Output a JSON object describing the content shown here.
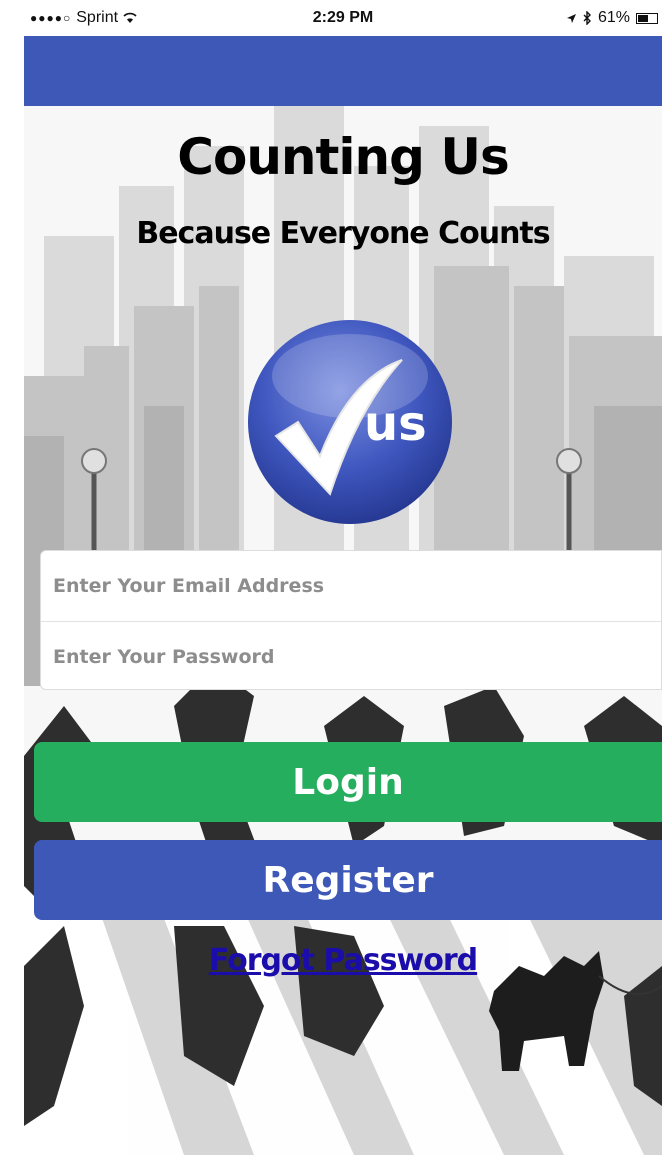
{
  "status_bar": {
    "signal": "●●●●○",
    "carrier": "Sprint",
    "time": "2:29 PM",
    "battery": "61%",
    "battery_level": 0.61
  },
  "header": {
    "title": "Counting Us",
    "subtitle": "Because Everyone Counts"
  },
  "logo": {
    "text": "us"
  },
  "form": {
    "email_placeholder": "Enter Your Email Address",
    "password_placeholder": "Enter Your Password",
    "email_value": "",
    "password_value": ""
  },
  "buttons": {
    "login_label": "Login",
    "register_label": "Register",
    "forgot_label": "Forgot Password"
  },
  "colors": {
    "app_bar": "#3e58b7",
    "login": "#26ae5f",
    "register": "#3e58b7",
    "link": "#1a0dab"
  }
}
